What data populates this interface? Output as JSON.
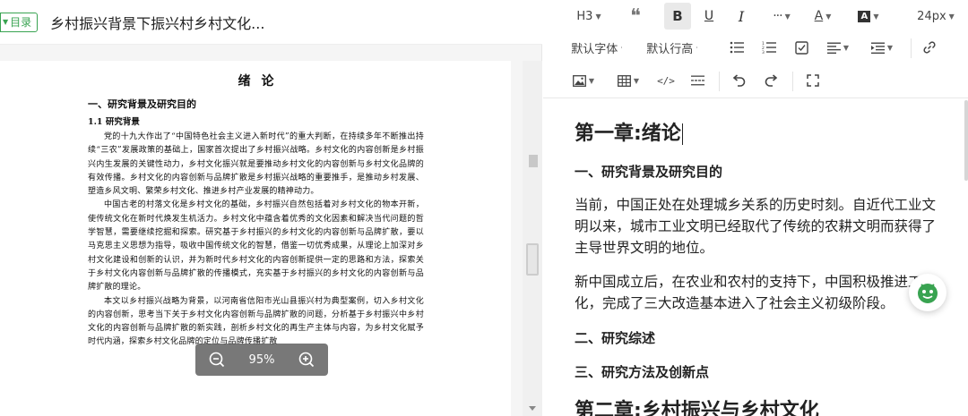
{
  "left": {
    "toc_label": "目录",
    "doc_title": "乡村振兴背景下振兴村乡村文化...",
    "page": {
      "title": "绪论",
      "h1": "一、研究背景及研究目的",
      "h2": "1.1 研究背景",
      "paragraphs": [
        "党的十九大作出了“中国特色社会主义进入新时代”的重大判断，在持续多年不断推出持续“三农”发展政策的基础上，国家首次提出了乡村振兴战略。乡村文化的内容创新是乡村振兴内生发展的关键性动力，乡村文化振兴就是要推动乡村文化的内容创新与乡村文化品牌的有效传播。乡村文化的内容创新与品牌扩散是乡村振兴战略的重要推手，是推动乡村发展、塑造乡风文明、繁荣乡村文化、推进乡村产业发展的精神动力。",
        "中国古老的村落文化是乡村文化的基础，乡村振兴自然包括着对乡村文化的物本开新，使传统文化在新时代焕发生机活力。乡村文化中蕴含着优秀的文化因素和解决当代问题的哲学智慧，需要继续挖掘和探索。研究基于乡村振兴的乡村文化的内容创新与品牌扩散，要以马克思主义思想为指导，吸收中国传统文化的智慧，借鉴一切优秀成果，从理论上加深对乡村文化建设和创新的认识，并为新时代乡村文化的内容创新提供一定的思路和方法，探索关于乡村文化内容创新与品牌扩散的传播模式，充实基于乡村振兴的乡村文化的内容创新与品牌扩散的理论。",
        "本文以乡村振兴战略为背景，以河南省信阳市光山县振兴村为典型案例，切入乡村文化的内容创新，思考当下关于乡村文化内容创新与品牌扩散的问题，分析基于乡村振兴中乡村文化的内容创新与品牌扩散的新实践，剖析乡村文化的再生产主体与内容，为乡村文化赋予时代内涵，探索乡村文化品牌的定位与品牌传播扩散"
      ]
    },
    "zoom": {
      "value": "95%"
    }
  },
  "toolbar": {
    "heading": "H3",
    "font_size": "24px",
    "font_family": "默认字体",
    "line_height": "默认行高"
  },
  "editor": {
    "h1": "第一章:绪论",
    "h2_1": "一、研究背景及研究目的",
    "p1": "当前，中国正处在处理城乡关系的历史时刻。自近代工业文明以来，城市工业文明已经取代了传统的农耕文明而获得了主导世界文明的地位。",
    "p2": "新中国成立后，在农业和农村的支持下，中国积极推进工业化，完成了三大改造基本进入了社会主义初级阶段。",
    "h2_2": "二、研究综述",
    "h2_3": "三、研究方法及创新点",
    "h1_2": "第二章:乡村振兴与乡村文化"
  },
  "colors": {
    "accent_green": "#39a351"
  }
}
